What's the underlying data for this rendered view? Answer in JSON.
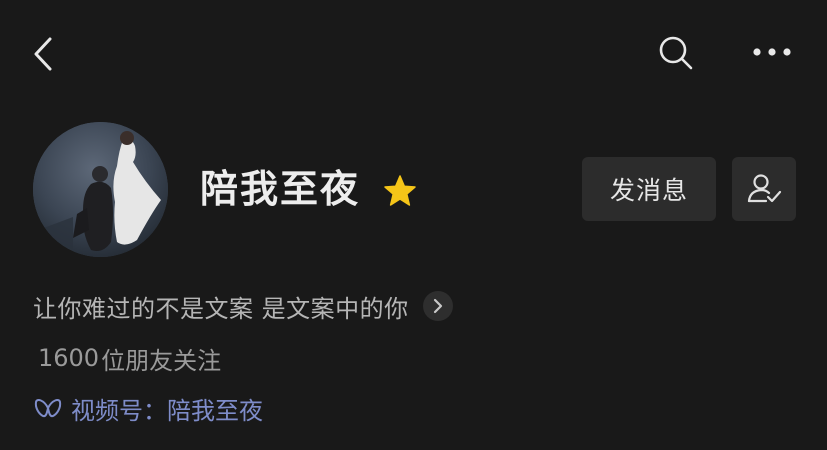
{
  "header": {
    "back_icon": "chevron-left-icon",
    "search_icon": "search-icon",
    "more_icon": "more-horizontal-icon"
  },
  "profile": {
    "name": "陪我至夜",
    "star_icon": "star-icon",
    "star_color": "#f5c518",
    "bio": "让你难过的不是文案 是文案中的你",
    "followers_count": "1600",
    "followers_label": "位朋友关注",
    "channel_label": "视频号：",
    "channel_name": "陪我至夜",
    "channel_color": "#7e8cc9"
  },
  "actions": {
    "message_label": "发消息",
    "follow_icon": "user-check-icon"
  },
  "colors": {
    "background": "#191919",
    "button_bg": "#2c2c2c"
  }
}
